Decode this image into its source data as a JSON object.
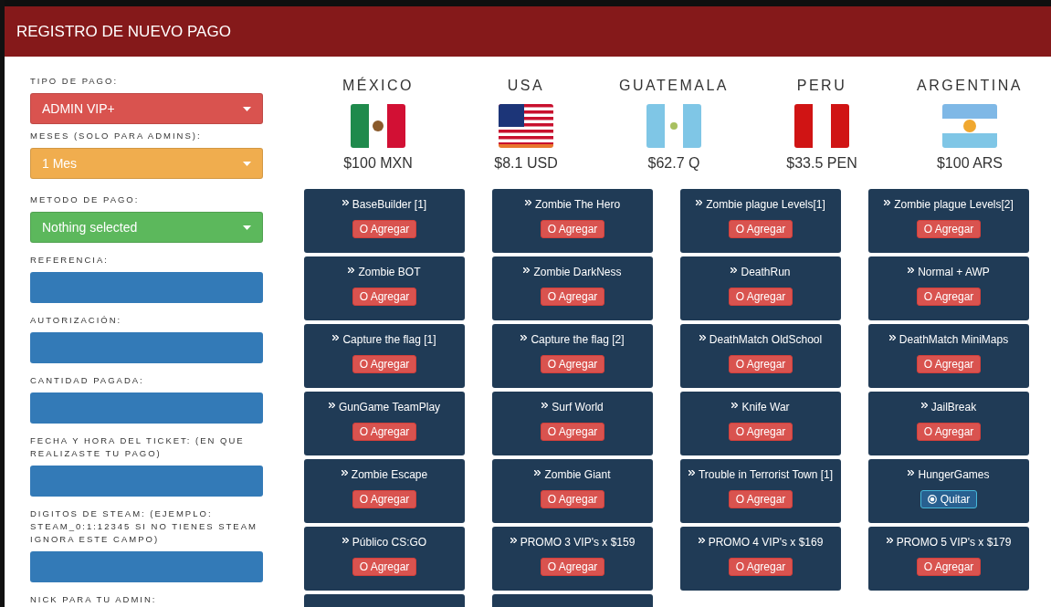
{
  "header": {
    "title": "REGISTRO DE NUEVO PAGO"
  },
  "form": [
    {
      "kind": "select",
      "label": "TIPO DE PAGO:",
      "value": "ADMIN VIP+",
      "color": "#d9534f"
    },
    {
      "kind": "select",
      "label": "MESES (SOLO PARA ADMINS):",
      "value": "1 Mes",
      "color": "#f0ad4e"
    },
    {
      "kind": "select",
      "label": "METODO DE PAGO:",
      "value": "Nothing selected",
      "color": "#5cb85c"
    },
    {
      "kind": "input",
      "label": "REFERENCIA:"
    },
    {
      "kind": "input",
      "label": "AUTORIZACIÓN:"
    },
    {
      "kind": "input",
      "label": "CANTIDAD PAGADA:"
    },
    {
      "kind": "input",
      "label": "FECHA Y HORA DEL TICKET: (EN QUE REALIZASTE TU PAGO)"
    },
    {
      "kind": "input",
      "label": "DIGITOS DE STEAM: (EJEMPLO: STEAM_0:1:12345 SI NO TIENES STEAM IGNORA ESTE CAMPO)"
    },
    {
      "kind": "label",
      "label": "NICK PARA TU ADMIN:"
    }
  ],
  "countries": [
    {
      "name": "MÉXICO",
      "kind": "mx",
      "price": "$100 MXN"
    },
    {
      "name": "USA",
      "kind": "us",
      "price": "$8.1 USD"
    },
    {
      "name": "GUATEMALA",
      "kind": "gt",
      "price": "$62.7 Q"
    },
    {
      "name": "PERU",
      "kind": "pe",
      "price": "$33.5 PEN"
    },
    {
      "name": "ARGENTINA",
      "kind": "ar",
      "price": "$100 ARS"
    }
  ],
  "servers": [
    {
      "kind": "server",
      "name": "BaseBuilder [1]",
      "button": "O Agregar",
      "selected": false
    },
    {
      "kind": "server",
      "name": "Zombie The Hero",
      "button": "O Agregar",
      "selected": false
    },
    {
      "kind": "server",
      "name": "Zombie plague Levels[1]",
      "button": "O Agregar",
      "selected": false
    },
    {
      "kind": "server",
      "name": "Zombie plague Levels[2]",
      "button": "O Agregar",
      "selected": false
    },
    {
      "kind": "server",
      "name": "Zombie BOT",
      "button": "O Agregar",
      "selected": false
    },
    {
      "kind": "server",
      "name": "Zombie DarkNess",
      "button": "O Agregar",
      "selected": false
    },
    {
      "kind": "server",
      "name": "DeathRun",
      "button": "O Agregar",
      "selected": false
    },
    {
      "kind": "server",
      "name": "Normal + AWP",
      "button": "O Agregar",
      "selected": false
    },
    {
      "kind": "server",
      "name": "Capture the flag [1]",
      "button": "O Agregar",
      "selected": false
    },
    {
      "kind": "server",
      "name": "Capture the flag [2]",
      "button": "O Agregar",
      "selected": false
    },
    {
      "kind": "server",
      "name": "DeathMatch OldSchool",
      "button": "O Agregar",
      "selected": false
    },
    {
      "kind": "server",
      "name": "DeathMatch MiniMaps",
      "button": "O Agregar",
      "selected": false
    },
    {
      "kind": "server",
      "name": "GunGame TeamPlay",
      "button": "O Agregar",
      "selected": false
    },
    {
      "kind": "server",
      "name": "Surf World",
      "button": "O Agregar",
      "selected": false
    },
    {
      "kind": "server",
      "name": "Knife War",
      "button": "O Agregar",
      "selected": false
    },
    {
      "kind": "server",
      "name": "JailBreak",
      "button": "O Agregar",
      "selected": false
    },
    {
      "kind": "server",
      "name": "Zombie Escape",
      "button": "O Agregar",
      "selected": false
    },
    {
      "kind": "server",
      "name": "Zombie Giant",
      "button": "O Agregar",
      "selected": false
    },
    {
      "kind": "server",
      "name": "Trouble in Terrorist Town [1]",
      "button": "O Agregar",
      "selected": false
    },
    {
      "kind": "server",
      "name": "HungerGames",
      "button": "Quitar",
      "selected": true
    },
    {
      "kind": "server",
      "name": "Público CS:GO",
      "button": "O Agregar",
      "selected": false
    },
    {
      "kind": "server",
      "name": "PROMO 3 VIP's x $159",
      "button": "O Agregar",
      "selected": false
    },
    {
      "kind": "server",
      "name": "PROMO 4 VIP's x $169",
      "button": "O Agregar",
      "selected": false
    },
    {
      "kind": "server",
      "name": "PROMO 5 VIP's x $179",
      "button": "O Agregar",
      "selected": false
    },
    {
      "kind": "partial"
    },
    {
      "kind": "partial"
    }
  ]
}
